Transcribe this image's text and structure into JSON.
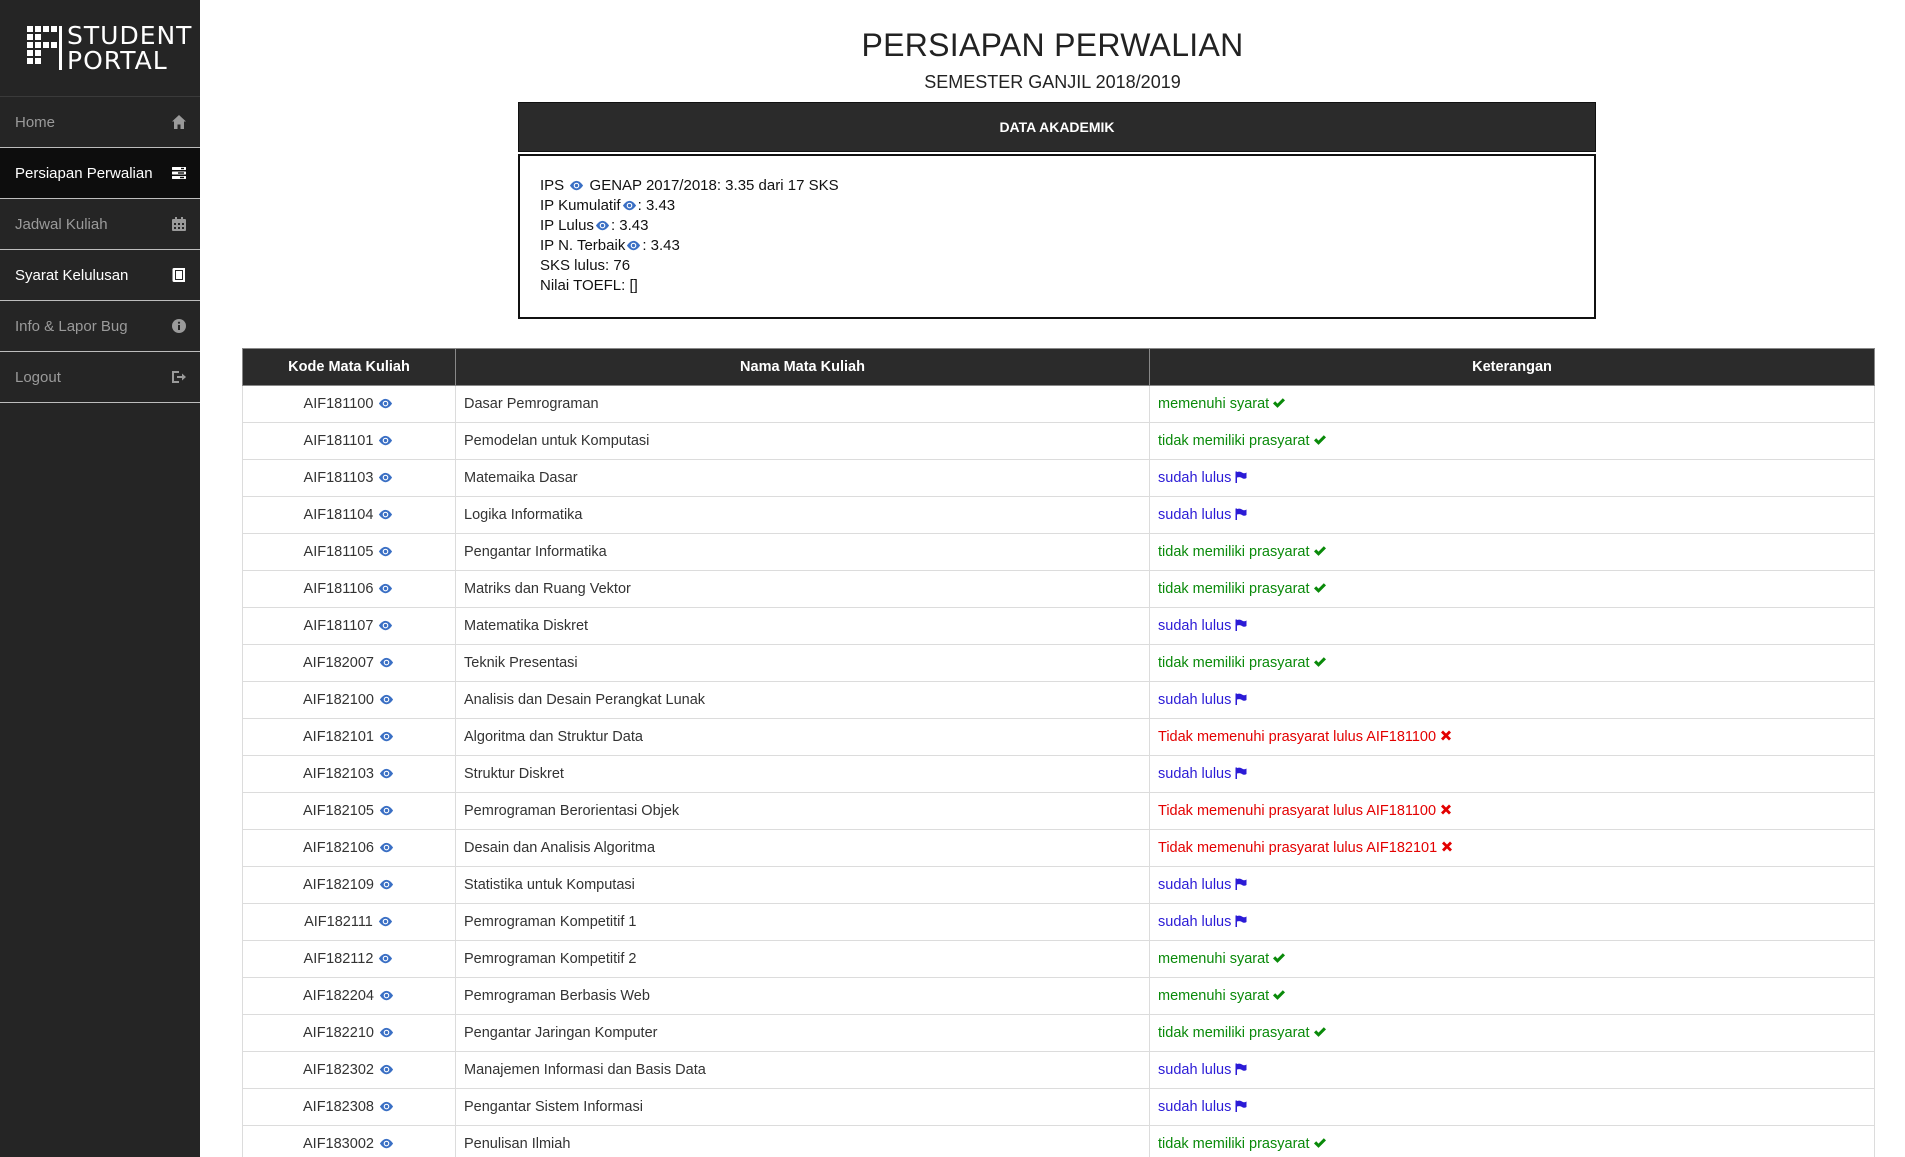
{
  "app": {
    "logo_text_line1": "STUDENT",
    "logo_text_line2": "PORTAL"
  },
  "sidebar": {
    "items": [
      {
        "label": "Home",
        "icon": "home-icon"
      },
      {
        "label": "Persiapan Perwalian",
        "icon": "tasks-icon"
      },
      {
        "label": "Jadwal Kuliah",
        "icon": "calendar-icon"
      },
      {
        "label": "Syarat Kelulusan",
        "icon": "book-icon"
      },
      {
        "label": "Info & Lapor Bug",
        "icon": "info-icon"
      },
      {
        "label": "Logout",
        "icon": "logout-icon"
      }
    ]
  },
  "page": {
    "title": "PERSIAPAN PERWALIAN",
    "subtitle": "SEMESTER GANJIL 2018/2019"
  },
  "akademik": {
    "header": "DATA AKADEMIK",
    "ips_label": "IPS",
    "ips_value": "GENAP 2017/2018: 3.35 dari 17 SKS",
    "ipk_label": "IP Kumulatif",
    "ipk_value": ": 3.43",
    "ipl_label": "IP Lulus",
    "ipl_value": ": 3.43",
    "ipt_label": "IP N. Terbaik",
    "ipt_value": ": 3.43",
    "sks": "SKS lulus: 76",
    "toefl": "Nilai TOEFL: []"
  },
  "table": {
    "headers": [
      "Kode Mata Kuliah",
      "Nama Mata Kuliah",
      "Keterangan"
    ],
    "rows": [
      {
        "kode": "AIF181100",
        "nama": "Dasar Pemrograman",
        "ket": "memenuhi syarat",
        "status": "ok"
      },
      {
        "kode": "AIF181101",
        "nama": "Pemodelan untuk Komputasi",
        "ket": "tidak memiliki prasyarat",
        "status": "ok"
      },
      {
        "kode": "AIF181103",
        "nama": "Matemaika Dasar",
        "ket": "sudah lulus",
        "status": "done"
      },
      {
        "kode": "AIF181104",
        "nama": "Logika Informatika",
        "ket": "sudah lulus",
        "status": "done"
      },
      {
        "kode": "AIF181105",
        "nama": "Pengantar Informatika",
        "ket": "tidak memiliki prasyarat",
        "status": "ok"
      },
      {
        "kode": "AIF181106",
        "nama": "Matriks dan Ruang Vektor",
        "ket": "tidak memiliki prasyarat",
        "status": "ok"
      },
      {
        "kode": "AIF181107",
        "nama": "Matematika Diskret",
        "ket": "sudah lulus",
        "status": "done"
      },
      {
        "kode": "AIF182007",
        "nama": "Teknik Presentasi",
        "ket": "tidak memiliki prasyarat",
        "status": "ok"
      },
      {
        "kode": "AIF182100",
        "nama": "Analisis dan Desain Perangkat Lunak",
        "ket": "sudah lulus",
        "status": "done"
      },
      {
        "kode": "AIF182101",
        "nama": "Algoritma dan Struktur Data",
        "ket": "Tidak memenuhi prasyarat lulus AIF181100",
        "status": "fail"
      },
      {
        "kode": "AIF182103",
        "nama": "Struktur Diskret",
        "ket": "sudah lulus",
        "status": "done"
      },
      {
        "kode": "AIF182105",
        "nama": "Pemrograman Berorientasi Objek",
        "ket": "Tidak memenuhi prasyarat lulus AIF181100",
        "status": "fail"
      },
      {
        "kode": "AIF182106",
        "nama": "Desain dan Analisis Algoritma",
        "ket": "Tidak memenuhi prasyarat lulus AIF182101",
        "status": "fail"
      },
      {
        "kode": "AIF182109",
        "nama": "Statistika untuk Komputasi",
        "ket": "sudah lulus",
        "status": "done"
      },
      {
        "kode": "AIF182111",
        "nama": "Pemrograman Kompetitif 1",
        "ket": "sudah lulus",
        "status": "done"
      },
      {
        "kode": "AIF182112",
        "nama": "Pemrograman Kompetitif 2",
        "ket": "memenuhi syarat",
        "status": "ok"
      },
      {
        "kode": "AIF182204",
        "nama": "Pemrograman Berbasis Web",
        "ket": "memenuhi syarat",
        "status": "ok"
      },
      {
        "kode": "AIF182210",
        "nama": "Pengantar Jaringan Komputer",
        "ket": "tidak memiliki prasyarat",
        "status": "ok"
      },
      {
        "kode": "AIF182302",
        "nama": "Manajemen Informasi dan Basis Data",
        "ket": "sudah lulus",
        "status": "done"
      },
      {
        "kode": "AIF182308",
        "nama": "Pengantar Sistem Informasi",
        "ket": "sudah lulus",
        "status": "done"
      },
      {
        "kode": "AIF183002",
        "nama": "Penulisan Ilmiah",
        "ket": "tidak memiliki prasyarat",
        "status": "ok"
      }
    ]
  },
  "colors": {
    "status_ok": "#0a8a0a",
    "status_done": "#2b1bd6",
    "status_fail": "#e30000",
    "sidebar_bg": "#252525",
    "header_bg": "#2b2b2b"
  }
}
